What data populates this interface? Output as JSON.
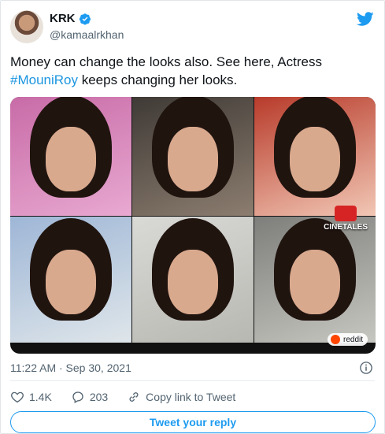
{
  "user": {
    "display_name": "KRK",
    "handle": "@kamaalrkhan"
  },
  "tweet": {
    "text_before": "Money can change the looks also. See here, Actress ",
    "hashtag": "#MouniRoy",
    "text_after": " keeps changing her looks."
  },
  "media": {
    "watermark_text": "CINETALES",
    "badge_text": "reddit"
  },
  "meta": {
    "timestamp": "11:22 AM · Sep 30, 2021"
  },
  "actions": {
    "likes": "1.4K",
    "replies": "203",
    "copy_link_label": "Copy link to Tweet"
  },
  "reply_button_label": "Tweet your reply",
  "colors": {
    "accent": "#1d9bf0",
    "hashtag": "#1b95e0",
    "secondary_text": "#536471"
  },
  "icons": [
    "verified-badge-icon",
    "twitter-logo-icon",
    "info-icon",
    "heart-icon",
    "reply-icon",
    "link-icon",
    "reddit-icon"
  ]
}
